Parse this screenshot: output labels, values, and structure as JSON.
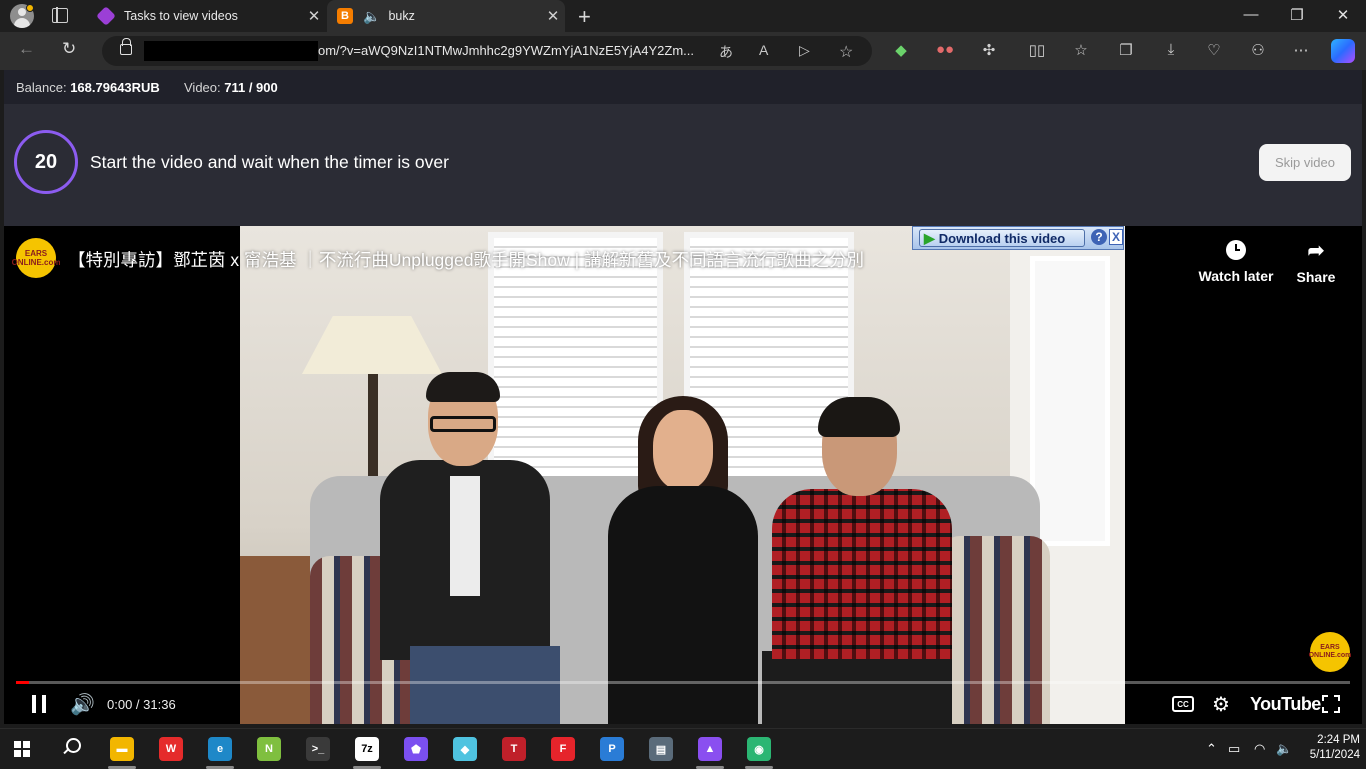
{
  "browser": {
    "tabs": [
      {
        "label": "Tasks to view videos",
        "close": "✕"
      },
      {
        "label": "bukz",
        "close": "✕"
      }
    ],
    "new_tab": "+",
    "window_controls": {
      "minimize": "—",
      "maximize": "❐",
      "close": "✕"
    },
    "address": {
      "url_visible": "om/?v=aWQ9NzI1NTMwJmhhc2g9YWZmYjA1NzE5YjA4Y2Zm...",
      "redacted_prefix": true
    },
    "blogger_favicon": "B"
  },
  "page": {
    "balance_label": "Balance: ",
    "balance_value": "168.79643RUB",
    "video_label": "Video: ",
    "video_value": "711 / 900",
    "timer_value": "20",
    "instruction": "Start the video and wait when the timer is over",
    "skip_button": "Skip video"
  },
  "player": {
    "title": "【特別專訪】鄧芷茵 x 甯浩基 ｜不流行曲Unplugged歌手開Show | 講解新舊及不同語言流行歌曲之分別",
    "channel_logo_text": "EARS ONLINE.com",
    "watch_later": "Watch later",
    "share": "Share",
    "download_button": "Download this video",
    "help": "?",
    "close": "X",
    "time": "0:00 / 31:36",
    "progress_fraction": 0.01,
    "cc": "CC",
    "brand": "YouTube"
  },
  "taskbar": {
    "time": "2:24 PM",
    "date": "5/11/2024",
    "apps": [
      {
        "name": "file-explorer",
        "color": "#f2b600",
        "glyph": "▬"
      },
      {
        "name": "wps-office",
        "color": "#e52b2b",
        "glyph": "W"
      },
      {
        "name": "edge",
        "color": "#1e88c8",
        "glyph": "e"
      },
      {
        "name": "notepad-plus",
        "color": "#7fbf3f",
        "glyph": "N"
      },
      {
        "name": "terminal",
        "color": "#3a3a3a",
        "glyph": ">_"
      },
      {
        "name": "7zip",
        "color": "#ffffff",
        "glyph": "7z"
      },
      {
        "name": "pentagon-app",
        "color": "#7b4ff0",
        "glyph": "⬟"
      },
      {
        "name": "crystal-app",
        "color": "#4fc3e0",
        "glyph": "◆"
      },
      {
        "name": "t-app",
        "color": "#c0202a",
        "glyph": "T"
      },
      {
        "name": "flipboard-app",
        "color": "#e6242b",
        "glyph": "F"
      },
      {
        "name": "pyramid-app",
        "color": "#2a7cd6",
        "glyph": "P"
      },
      {
        "name": "monitor-app",
        "color": "#5a6b7a",
        "glyph": "▤"
      },
      {
        "name": "mountain-app",
        "color": "#8a4ff0",
        "glyph": "▲"
      },
      {
        "name": "android-app",
        "color": "#2bb673",
        "glyph": "◉"
      }
    ]
  }
}
